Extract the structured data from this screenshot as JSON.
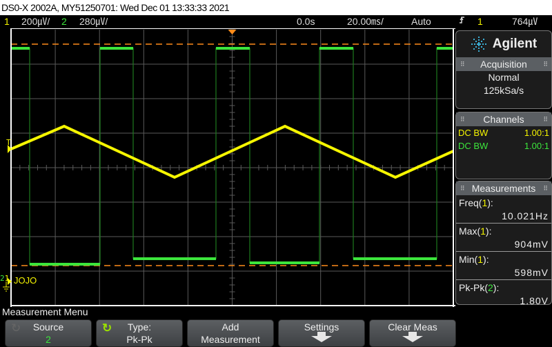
{
  "title_bar": "DS0-X 2002A, MY51250701: Wed Dec 01 13:33:33 2021",
  "status": {
    "ch1_label": "1",
    "ch1_scale": "200㎶/",
    "ch2_label": "2",
    "ch2_scale": "280㎶/",
    "time_offset": "0.0s",
    "time_scale": "20.00㎳/",
    "trigger_mode": "Auto",
    "trigger_edge_icon": "rising-edge-icon",
    "trigger_source": "1",
    "trigger_level": "764㎶"
  },
  "colors": {
    "ch1": "#f5f500",
    "ch2": "#3ce63c",
    "grid": "#5a5a5a",
    "cursor": "#ff8c1a",
    "logo": "#3bb0d8"
  },
  "side": {
    "brand": "Agilent",
    "acquisition": {
      "title": "Acquisition",
      "mode": "Normal",
      "rate": "125kSa/s"
    },
    "channels": {
      "title": "Channels",
      "rows": [
        {
          "coupling": "DC BW",
          "probe": "1.00:1"
        },
        {
          "coupling": "DC BW",
          "probe": "1.00:1"
        }
      ]
    },
    "measurements": {
      "title": "Measurements",
      "items": [
        {
          "name": "Freq(",
          "src": "1",
          "close": "):",
          "value": "10.021Hz"
        },
        {
          "name": "Max(",
          "src": "1",
          "close": "):",
          "value": "904mV"
        },
        {
          "name": "Min(",
          "src": "1",
          "close": "):",
          "value": "598mV"
        },
        {
          "name": "Pk-Pk(",
          "src": "2",
          "close": "):",
          "value": "1.80V"
        }
      ]
    }
  },
  "plot": {
    "trigger_marker": "T",
    "ground_label": "JOJO",
    "ground_ch1": "1",
    "ground_ch2": "2"
  },
  "menu": {
    "title": "Measurement Menu",
    "softkeys": [
      {
        "line1": "Source",
        "line2": "2"
      },
      {
        "line1": "Type:",
        "line2": "Pk-Pk"
      },
      {
        "line1": "Add",
        "line2": "Measurement"
      },
      {
        "line1": "Settings",
        "line2": ""
      },
      {
        "line1": "Clear Meas",
        "line2": ""
      }
    ]
  }
}
